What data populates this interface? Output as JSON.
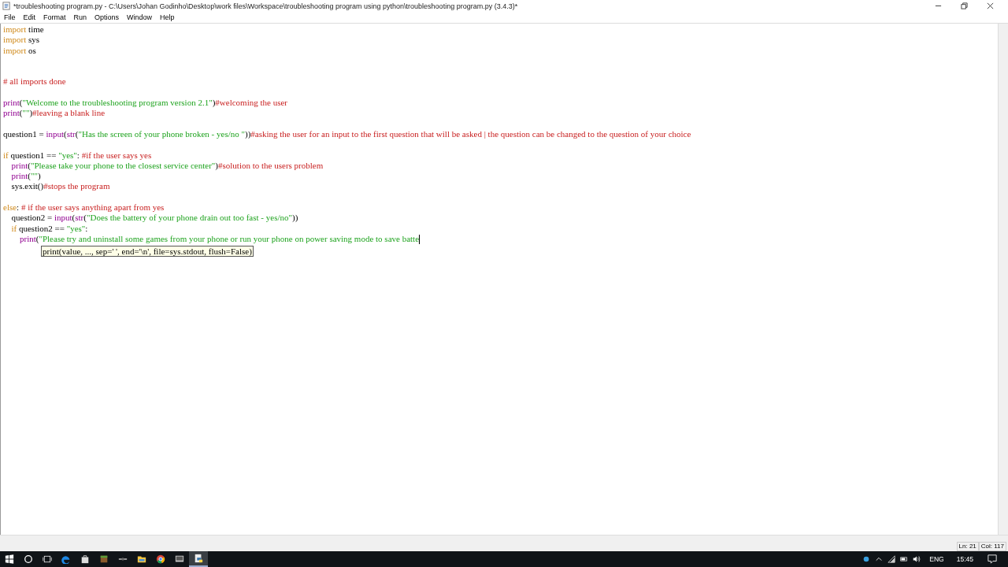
{
  "window": {
    "title": "*troubleshooting program.py - C:\\Users\\Johan Godinho\\Desktop\\work files\\Workspace\\troubleshooting program using python\\troubleshooting program.py (3.4.3)*"
  },
  "menu": [
    "File",
    "Edit",
    "Format",
    "Run",
    "Options",
    "Window",
    "Help"
  ],
  "code": [
    {
      "kind": "code",
      "tokens": [
        {
          "kind": "keyword",
          "text": "import"
        },
        {
          "kind": "plain",
          "text": " time"
        }
      ]
    },
    {
      "kind": "code",
      "tokens": [
        {
          "kind": "keyword",
          "text": "import"
        },
        {
          "kind": "plain",
          "text": " sys"
        }
      ]
    },
    {
      "kind": "code",
      "tokens": [
        {
          "kind": "keyword",
          "text": "import"
        },
        {
          "kind": "plain",
          "text": " os"
        }
      ]
    },
    {
      "kind": "blank"
    },
    {
      "kind": "blank"
    },
    {
      "kind": "code",
      "tokens": [
        {
          "kind": "comment",
          "text": "# all imports done"
        }
      ]
    },
    {
      "kind": "blank"
    },
    {
      "kind": "code",
      "tokens": [
        {
          "kind": "builtin",
          "text": "print"
        },
        {
          "kind": "plain",
          "text": "("
        },
        {
          "kind": "string",
          "text": "\"Welcome to the troubleshooting program version 2.1\""
        },
        {
          "kind": "plain",
          "text": ")"
        },
        {
          "kind": "comment",
          "text": "#welcoming the user"
        }
      ]
    },
    {
      "kind": "code",
      "tokens": [
        {
          "kind": "builtin",
          "text": "print"
        },
        {
          "kind": "plain",
          "text": "("
        },
        {
          "kind": "string",
          "text": "\"\""
        },
        {
          "kind": "plain",
          "text": ")"
        },
        {
          "kind": "comment",
          "text": "#leaving a blank line"
        }
      ]
    },
    {
      "kind": "blank"
    },
    {
      "kind": "code",
      "tokens": [
        {
          "kind": "plain",
          "text": "question1 = "
        },
        {
          "kind": "builtin",
          "text": "input"
        },
        {
          "kind": "plain",
          "text": "("
        },
        {
          "kind": "builtin",
          "text": "str"
        },
        {
          "kind": "plain",
          "text": "("
        },
        {
          "kind": "string",
          "text": "\"Has the screen of your phone broken - yes/no \""
        },
        {
          "kind": "plain",
          "text": "))"
        },
        {
          "kind": "comment",
          "text": "#asking the user for an input to the first question that will be asked | the question can be changed to the question of your choice"
        }
      ]
    },
    {
      "kind": "blank"
    },
    {
      "kind": "code",
      "tokens": [
        {
          "kind": "keyword",
          "text": "if"
        },
        {
          "kind": "plain",
          "text": " question1 == "
        },
        {
          "kind": "string",
          "text": "\"yes\""
        },
        {
          "kind": "plain",
          "text": ": "
        },
        {
          "kind": "comment",
          "text": "#if the user says yes"
        }
      ],
      "children": [
        {
          "kind": "code",
          "tokens": [
            {
              "kind": "builtin",
              "text": "print"
            },
            {
              "kind": "plain",
              "text": "("
            },
            {
              "kind": "string",
              "text": "\"Please take your phone to the closest service center\""
            },
            {
              "kind": "plain",
              "text": ")"
            },
            {
              "kind": "comment",
              "text": "#solution to the users problem"
            }
          ]
        },
        {
          "kind": "code",
          "tokens": [
            {
              "kind": "builtin",
              "text": "print"
            },
            {
              "kind": "plain",
              "text": "("
            },
            {
              "kind": "string",
              "text": "\"\""
            },
            {
              "kind": "plain",
              "text": ")"
            }
          ]
        },
        {
          "kind": "code",
          "tokens": [
            {
              "kind": "plain",
              "text": "sys.exit()"
            },
            {
              "kind": "comment",
              "text": "#stops the program"
            }
          ]
        },
        {
          "kind": "blank"
        }
      ]
    },
    {
      "kind": "code",
      "tokens": [
        {
          "kind": "keyword",
          "text": "else"
        },
        {
          "kind": "plain",
          "text": ": "
        },
        {
          "kind": "comment",
          "text": "# if the user says anything apart from yes"
        }
      ],
      "children": [
        {
          "kind": "code",
          "tokens": [
            {
              "kind": "plain",
              "text": "question2 = "
            },
            {
              "kind": "builtin",
              "text": "input"
            },
            {
              "kind": "plain",
              "text": "("
            },
            {
              "kind": "builtin",
              "text": "str"
            },
            {
              "kind": "plain",
              "text": "("
            },
            {
              "kind": "string",
              "text": "\"Does the battery of your phone drain out too fast - yes/no\""
            },
            {
              "kind": "plain",
              "text": "))"
            }
          ]
        },
        {
          "kind": "code",
          "tokens": [
            {
              "kind": "keyword",
              "text": "if"
            },
            {
              "kind": "plain",
              "text": " question2 == "
            },
            {
              "kind": "string",
              "text": "\"yes\""
            },
            {
              "kind": "plain",
              "text": ":"
            }
          ],
          "children": [
            {
              "kind": "code",
              "cursor": true,
              "tokens": [
                {
                  "kind": "builtin",
                  "text": "print"
                },
                {
                  "kind": "plain",
                  "text": "("
                },
                {
                  "kind": "string",
                  "text": "\"Please try and uninstall some games from your phone or run your phone on power saving mode to save batte"
                }
              ]
            }
          ]
        }
      ]
    }
  ],
  "calltip": "print(value, ..., sep=' ', end='\\n', file=sys.stdout, flush=False)",
  "status_bar": {
    "line": "Ln: 21",
    "column": "Col: 117"
  },
  "taskbar": {
    "language": "ENG",
    "time": "15:45"
  }
}
